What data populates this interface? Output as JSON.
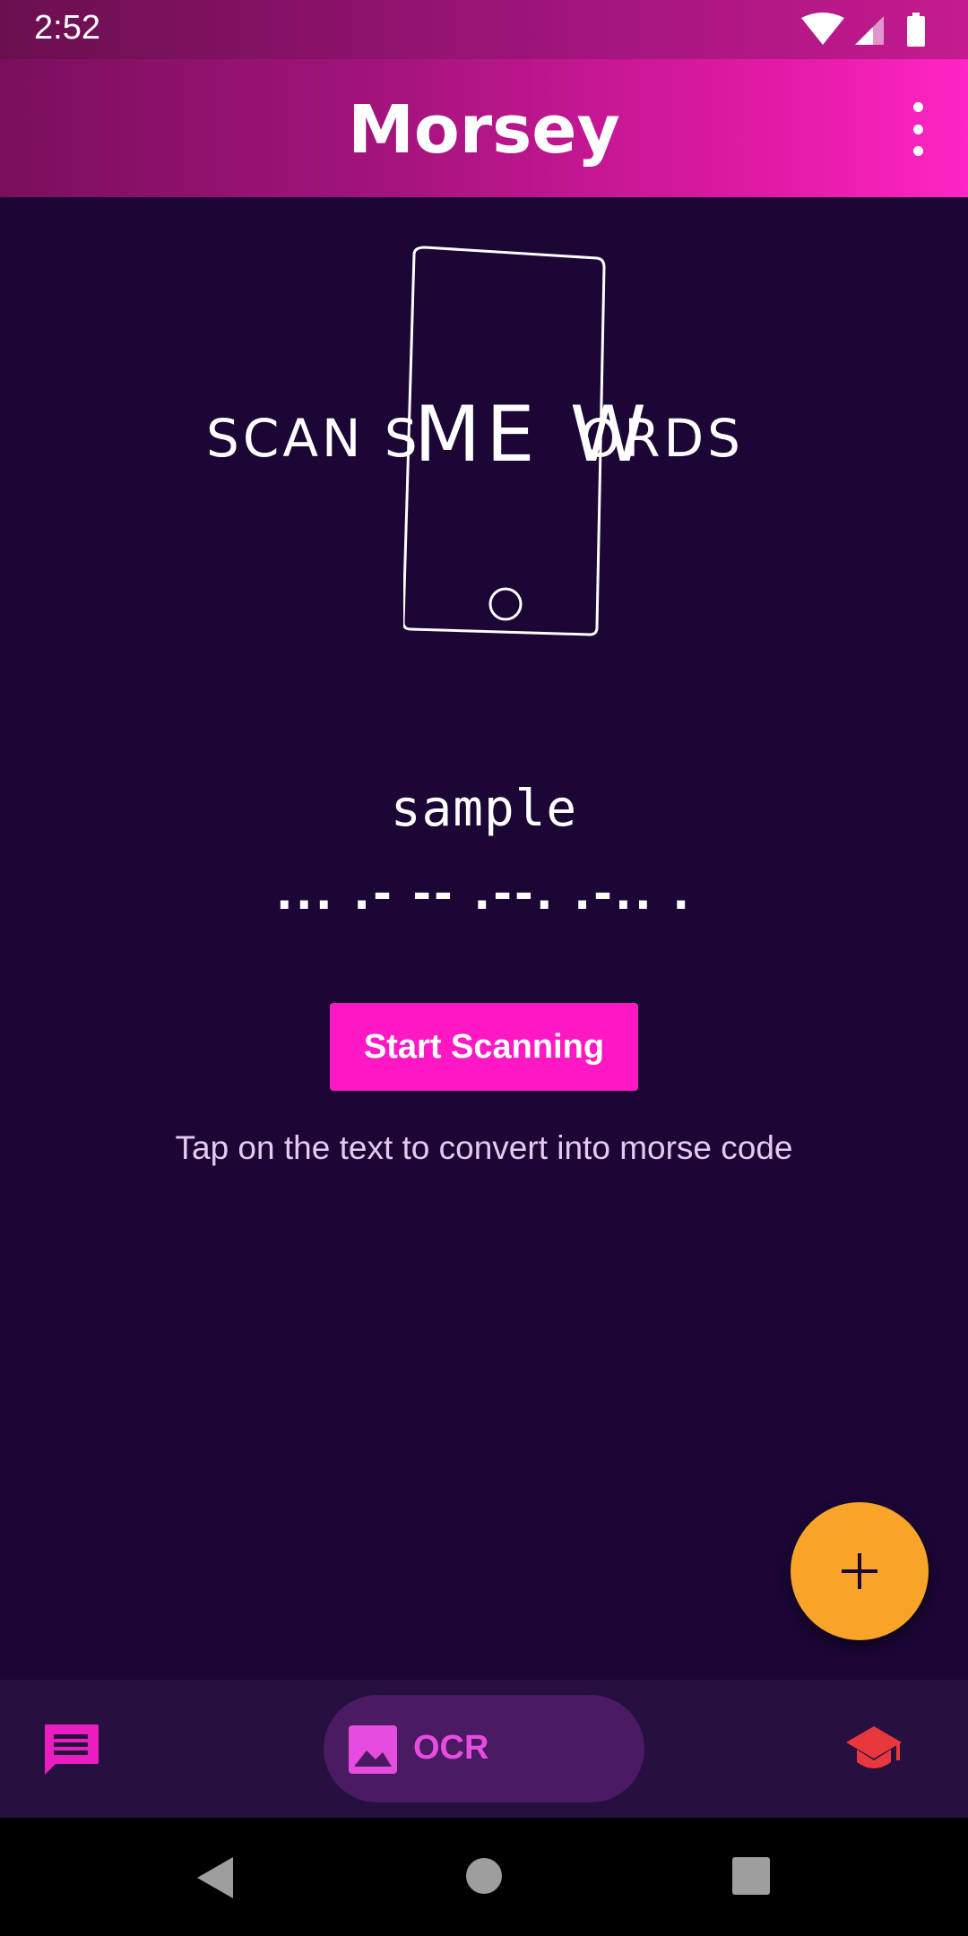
{
  "status_bar": {
    "time": "2:52",
    "icons": [
      "wifi-icon",
      "cellular-signal-icon",
      "battery-icon"
    ]
  },
  "app_bar": {
    "title": "Morsey",
    "overflow_icon": "more-vert-icon"
  },
  "illustration": {
    "left_text": "SCAN S",
    "middle_text": "ME W",
    "right_text": "ORDS",
    "icon": "phone-icon"
  },
  "main": {
    "sample_word": "sample",
    "morse_code": "... .- -- .--. .-.. .",
    "start_button_label": "Start Scanning",
    "hint": "Tap on the text to convert into morse code"
  },
  "fab": {
    "icon": "plus-icon",
    "color": "#f7a428"
  },
  "bottom_nav": {
    "items": [
      {
        "icon": "chat-icon",
        "label": ""
      },
      {
        "icon": "image-icon",
        "label": "OCR",
        "selected": true
      },
      {
        "icon": "school-icon",
        "label": ""
      }
    ]
  },
  "system_nav": {
    "icons": [
      "back-icon",
      "home-icon",
      "recents-icon"
    ]
  },
  "colors": {
    "background": "#1b0635",
    "accent": "#ff18c4",
    "fab": "#f7a428",
    "nav_bar": "#25103f",
    "ocr_pill": "#4a1a63",
    "ocr_label": "#e64ce0",
    "learn_icon": "#e8383d"
  }
}
